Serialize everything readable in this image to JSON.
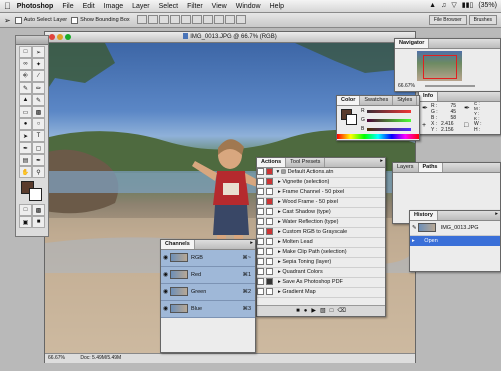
{
  "menubar": {
    "app_name": "Photoshop",
    "items": [
      "File",
      "Edit",
      "Image",
      "Layer",
      "Select",
      "Filter",
      "View",
      "Window",
      "Help"
    ],
    "battery": "(35%)"
  },
  "options_bar": {
    "auto_select_label": "Auto Select Layer",
    "bounding_box_label": "Show Bounding Box",
    "file_browser_label": "File Browser",
    "brushes_label": "Brushes"
  },
  "document": {
    "title": "IMG_0013.JPG @ 66.7% (RGB)",
    "zoom": "66.67%",
    "doc_size": "Doc: 5.49M/5.49M"
  },
  "navigator": {
    "tab": "Navigator",
    "zoom": "66.67%"
  },
  "info": {
    "tab": "Info",
    "r_label": "R :",
    "r_value": "75",
    "g_label": "G :",
    "g_value": "45",
    "b_label": "B :",
    "b_value": "58",
    "c_label": "C :",
    "m_label": "M :",
    "y_label": "Y :",
    "k_label": "K :",
    "x_label": "X :",
    "x_value": "2.416",
    "yy_label": "Y :",
    "yy_value": "2.156",
    "w_label": "W :",
    "h_label": "H :"
  },
  "color": {
    "tabs": [
      "Color",
      "Swatches",
      "Styles"
    ],
    "r_label": "R",
    "g_label": "G",
    "b_label": "B",
    "fg_color": "#5a3b2c"
  },
  "actions": {
    "tabs": [
      "Actions",
      "Tool Presets"
    ],
    "items": [
      "Default Actions.atn",
      "Vignette (selection)",
      "Frame Channel - 50 pixel",
      "Wood Frame - 50 pixel",
      "Cast Shadow (type)",
      "Water Reflection (type)",
      "Custom RGB to Grayscale",
      "Molten Lead",
      "Make Clip Path (selection)",
      "Sepia Toning (layer)",
      "Quadrant Colors",
      "Save As Photoshop PDF",
      "Gradient Map"
    ]
  },
  "layers_paths": {
    "tabs": [
      "Layers",
      "Paths"
    ]
  },
  "channels": {
    "tab": "Channels",
    "items": [
      {
        "name": "RGB",
        "shortcut": "⌘~"
      },
      {
        "name": "Red",
        "shortcut": "⌘1"
      },
      {
        "name": "Green",
        "shortcut": "⌘2"
      },
      {
        "name": "Blue",
        "shortcut": "⌘3"
      }
    ]
  },
  "history": {
    "tab": "History",
    "snapshot": "IMG_0013.JPG",
    "state": "Open"
  },
  "colors": {
    "accent": "#3a6fd8",
    "channel_row": "#9fb8d8"
  }
}
